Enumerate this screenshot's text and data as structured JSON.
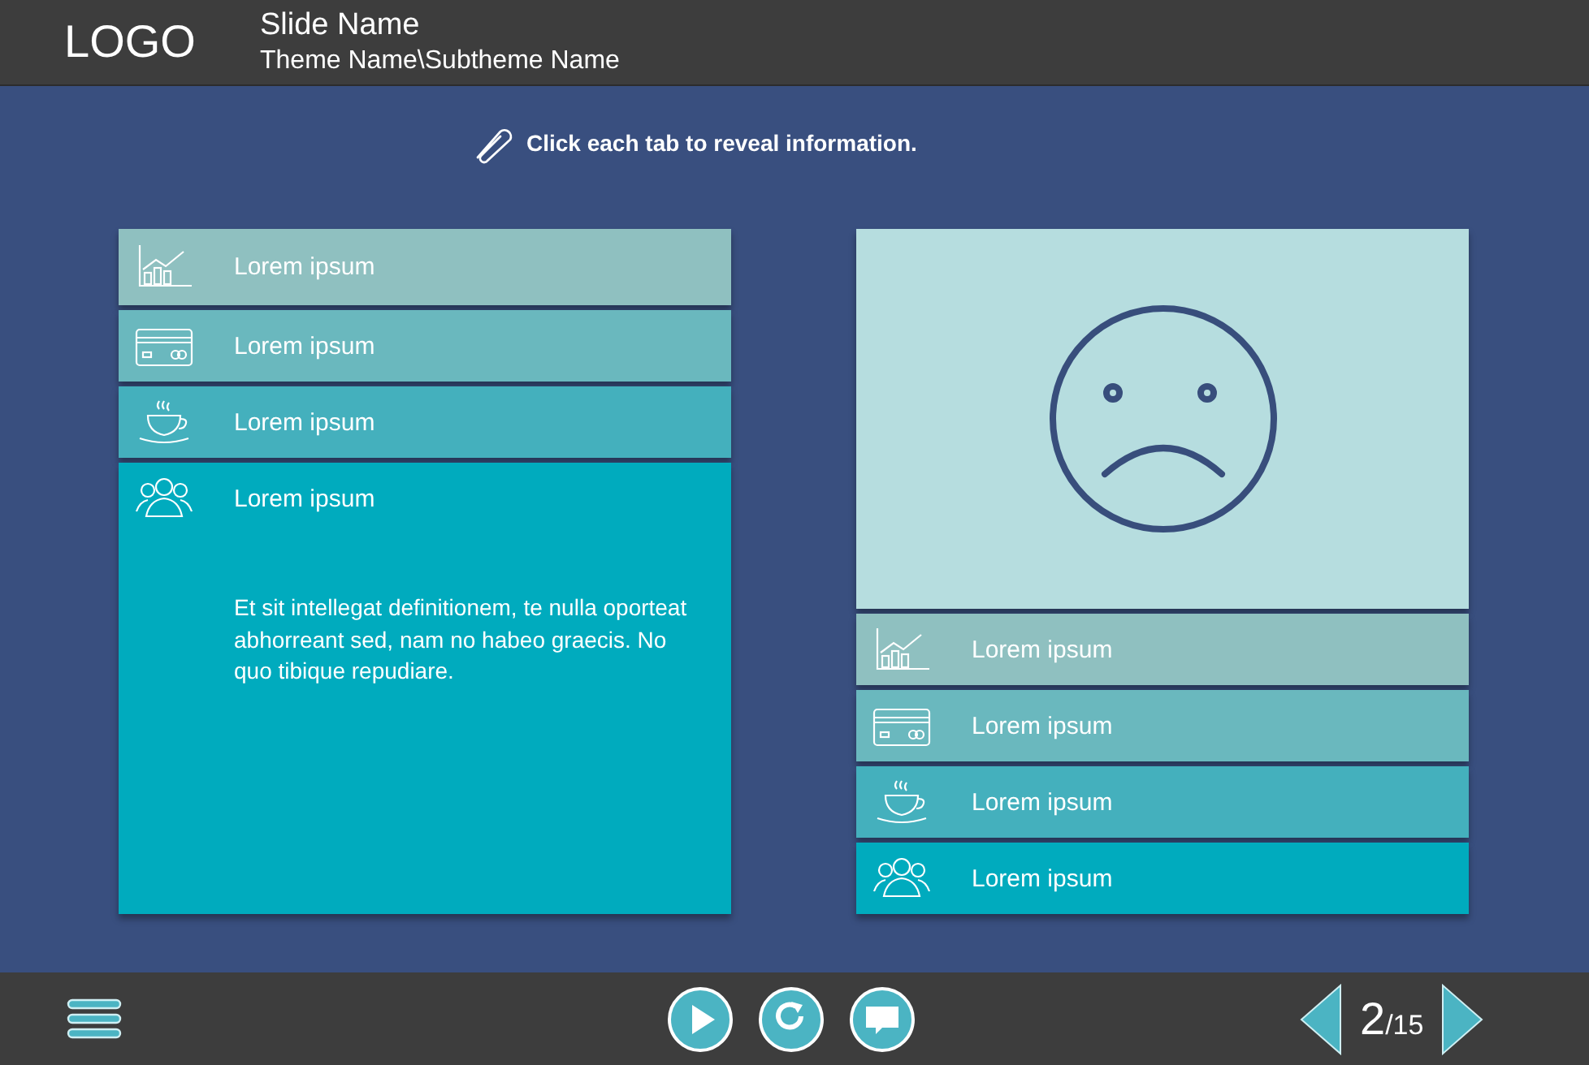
{
  "header": {
    "logo": "LOGO",
    "slide_name": "Slide Name",
    "theme": "Theme Name\\Subtheme Name"
  },
  "instruction": "Click each tab to reveal information.",
  "left_panel": {
    "tabs": [
      {
        "label": "Lorem ipsum",
        "color": "#8fc0c0",
        "selected": false
      },
      {
        "label": "Lorem ipsum",
        "color": "#6ab8be",
        "selected": false
      },
      {
        "label": "Lorem ipsum",
        "color": "#44b0bd",
        "selected": false
      },
      {
        "label": "Lorem ipsum",
        "color": "#00abbe",
        "selected": true,
        "body": "Et sit intellegat definitionem, te nulla oporteat abhorreant sed, nam no habeo graecis. No quo tibique repudiare."
      }
    ]
  },
  "right_panel": {
    "tabs": [
      {
        "label": "Lorem ipsum",
        "color": "#8fc0c0"
      },
      {
        "label": "Lorem ipsum",
        "color": "#6ab8be"
      },
      {
        "label": "Lorem ipsum",
        "color": "#44b0bd"
      },
      {
        "label": "Lorem ipsum",
        "color": "#00abbe"
      }
    ]
  },
  "footer": {
    "page": "2",
    "total": "/15"
  }
}
